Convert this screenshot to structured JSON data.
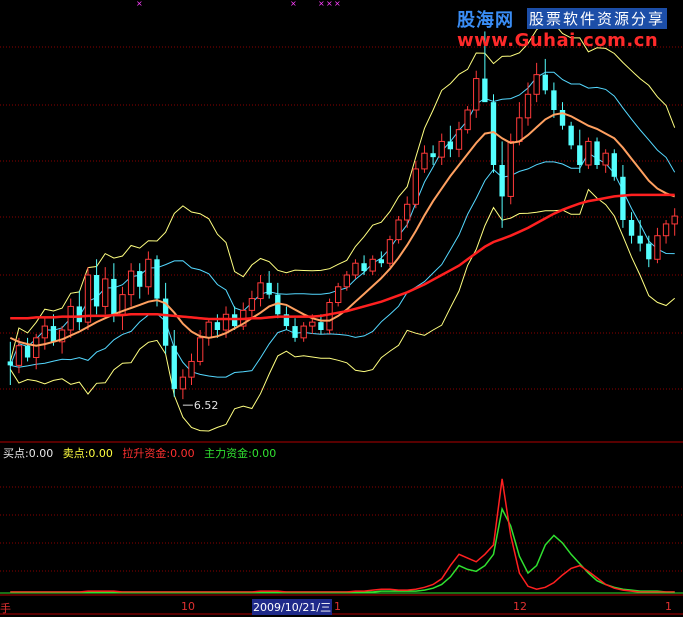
{
  "watermark": {
    "brand": "股海网",
    "slogan": "股票软件资源分享",
    "url": "www.Guhai.com.cn"
  },
  "indicator_legend": {
    "buy": {
      "label": "买点:0.00",
      "color": "#e8e8e8"
    },
    "sell": {
      "label": "卖点:0.00",
      "color": "#ffff40"
    },
    "pull_funds": {
      "label": "拉升资金:0.00",
      "color": "#ff3030"
    },
    "main_funds": {
      "label": "主力资金:0.00",
      "color": "#30e030"
    }
  },
  "x_axis": {
    "left_marker": "手",
    "tick_10": "10",
    "cursor_date": "2009/10/21/三",
    "tick_11": "1",
    "tick_12": "12",
    "right_marker": "1"
  },
  "colors": {
    "up": "#ff3a3a",
    "down": "#54ffff",
    "ma_short": "#ffa060",
    "ma_long": "#ff2020",
    "ma_green": "#30e030",
    "band_upper": "#ffff80",
    "band_cyan": "#54d8ff",
    "grid": "#8a0000"
  },
  "chart_data": [
    {
      "type": "candlestick",
      "title": "",
      "annotation": "6.52",
      "series": [
        {
          "name": "",
          "ohlc": [
            [
              7.0,
              7.25,
              6.7,
              6.95
            ],
            [
              6.95,
              7.3,
              6.85,
              7.2
            ],
            [
              7.2,
              7.3,
              7.0,
              7.05
            ],
            [
              7.05,
              7.35,
              6.9,
              7.3
            ],
            [
              7.3,
              7.55,
              7.15,
              7.45
            ],
            [
              7.45,
              7.6,
              7.2,
              7.25
            ],
            [
              7.25,
              7.45,
              7.1,
              7.4
            ],
            [
              7.4,
              7.8,
              7.3,
              7.7
            ],
            [
              7.7,
              7.9,
              7.4,
              7.5
            ],
            [
              7.5,
              8.2,
              7.4,
              8.1
            ],
            [
              8.1,
              8.3,
              7.6,
              7.7
            ],
            [
              7.7,
              8.2,
              7.6,
              8.05
            ],
            [
              8.05,
              8.25,
              7.5,
              7.6
            ],
            [
              7.6,
              7.95,
              7.4,
              7.85
            ],
            [
              7.85,
              8.25,
              7.7,
              8.15
            ],
            [
              8.15,
              8.25,
              7.8,
              7.95
            ],
            [
              7.95,
              8.4,
              7.85,
              8.3
            ],
            [
              8.3,
              8.35,
              7.7,
              7.8
            ],
            [
              7.8,
              8.0,
              7.1,
              7.2
            ],
            [
              7.2,
              7.4,
              6.55,
              6.65
            ],
            [
              6.65,
              6.9,
              6.52,
              6.8
            ],
            [
              6.8,
              7.1,
              6.7,
              7.0
            ],
            [
              7.0,
              7.4,
              6.95,
              7.3
            ],
            [
              7.3,
              7.55,
              7.2,
              7.5
            ],
            [
              7.5,
              7.6,
              7.3,
              7.4
            ],
            [
              7.4,
              7.7,
              7.3,
              7.6
            ],
            [
              7.6,
              7.7,
              7.4,
              7.45
            ],
            [
              7.45,
              7.75,
              7.4,
              7.65
            ],
            [
              7.65,
              7.9,
              7.55,
              7.8
            ],
            [
              7.8,
              8.1,
              7.7,
              8.0
            ],
            [
              8.0,
              8.15,
              7.8,
              7.85
            ],
            [
              7.85,
              8.0,
              7.55,
              7.6
            ],
            [
              7.6,
              7.7,
              7.4,
              7.45
            ],
            [
              7.45,
              7.55,
              7.25,
              7.3
            ],
            [
              7.3,
              7.5,
              7.25,
              7.45
            ],
            [
              7.45,
              7.6,
              7.35,
              7.5
            ],
            [
              7.5,
              7.6,
              7.35,
              7.4
            ],
            [
              7.4,
              7.8,
              7.35,
              7.75
            ],
            [
              7.75,
              8.0,
              7.7,
              7.95
            ],
            [
              7.95,
              8.15,
              7.9,
              8.1
            ],
            [
              8.1,
              8.3,
              8.05,
              8.25
            ],
            [
              8.25,
              8.35,
              8.1,
              8.15
            ],
            [
              8.15,
              8.35,
              8.1,
              8.3
            ],
            [
              8.3,
              8.4,
              8.2,
              8.25
            ],
            [
              8.25,
              8.6,
              8.2,
              8.55
            ],
            [
              8.55,
              8.85,
              8.5,
              8.8
            ],
            [
              8.8,
              9.1,
              8.7,
              9.0
            ],
            [
              9.0,
              9.55,
              8.95,
              9.45
            ],
            [
              9.45,
              9.75,
              9.4,
              9.65
            ],
            [
              9.65,
              9.75,
              9.5,
              9.6
            ],
            [
              9.6,
              9.9,
              9.5,
              9.8
            ],
            [
              9.8,
              10.0,
              9.6,
              9.7
            ],
            [
              9.7,
              10.05,
              9.6,
              9.95
            ],
            [
              9.95,
              10.25,
              9.9,
              10.2
            ],
            [
              10.2,
              10.7,
              10.1,
              10.6
            ],
            [
              10.6,
              11.2,
              10.4,
              10.3
            ],
            [
              10.3,
              10.4,
              9.4,
              9.5
            ],
            [
              9.5,
              9.8,
              8.7,
              9.1
            ],
            [
              9.1,
              9.9,
              9.0,
              9.8
            ],
            [
              9.8,
              10.3,
              9.75,
              10.1
            ],
            [
              10.1,
              10.55,
              10.0,
              10.4
            ],
            [
              10.4,
              10.8,
              10.3,
              10.65
            ],
            [
              10.65,
              10.85,
              10.4,
              10.45
            ],
            [
              10.45,
              10.55,
              10.1,
              10.2
            ],
            [
              10.2,
              10.3,
              9.95,
              10.0
            ],
            [
              10.0,
              10.05,
              9.7,
              9.75
            ],
            [
              9.75,
              9.95,
              9.4,
              9.5
            ],
            [
              9.5,
              9.85,
              9.45,
              9.8
            ],
            [
              9.8,
              9.85,
              9.45,
              9.5
            ],
            [
              9.5,
              9.7,
              9.4,
              9.65
            ],
            [
              9.65,
              9.7,
              9.3,
              9.35
            ],
            [
              9.35,
              9.5,
              8.7,
              8.8
            ],
            [
              8.8,
              8.9,
              8.5,
              8.6
            ],
            [
              8.6,
              8.8,
              8.4,
              8.5
            ],
            [
              8.5,
              8.6,
              8.2,
              8.3
            ],
            [
              8.3,
              8.7,
              8.25,
              8.6
            ],
            [
              8.6,
              8.8,
              8.5,
              8.75
            ],
            [
              8.75,
              8.95,
              8.6,
              8.85
            ]
          ]
        },
        {
          "name": "",
          "type": "line",
          "values": [
            7.3,
            7.25,
            7.22,
            7.2,
            7.22,
            7.25,
            7.28,
            7.33,
            7.38,
            7.44,
            7.5,
            7.55,
            7.6,
            7.64,
            7.68,
            7.72,
            7.76,
            7.78,
            7.74,
            7.62,
            7.48,
            7.38,
            7.32,
            7.3,
            7.32,
            7.36,
            7.42,
            7.48,
            7.55,
            7.62,
            7.7,
            7.74,
            7.72,
            7.66,
            7.6,
            7.55,
            7.52,
            7.52,
            7.58,
            7.66,
            7.76,
            7.86,
            7.96,
            8.06,
            8.18,
            8.32,
            8.48,
            8.66,
            8.86,
            9.04,
            9.2,
            9.36,
            9.5,
            9.64,
            9.78,
            9.9,
            9.92,
            9.84,
            9.78,
            9.8,
            9.88,
            9.98,
            10.08,
            10.14,
            10.16,
            10.12,
            10.06,
            10.0,
            9.96,
            9.9,
            9.84,
            9.72,
            9.58,
            9.44,
            9.3,
            9.2,
            9.14,
            9.1
          ]
        },
        {
          "name": "",
          "type": "line",
          "values": [
            7.55,
            7.55,
            7.55,
            7.56,
            7.56,
            7.56,
            7.57,
            7.57,
            7.57,
            7.58,
            7.58,
            7.58,
            7.59,
            7.59,
            7.6,
            7.6,
            7.6,
            7.6,
            7.59,
            7.58,
            7.57,
            7.56,
            7.55,
            7.54,
            7.54,
            7.54,
            7.54,
            7.54,
            7.55,
            7.55,
            7.56,
            7.57,
            7.57,
            7.57,
            7.57,
            7.57,
            7.58,
            7.6,
            7.62,
            7.64,
            7.67,
            7.7,
            7.73,
            7.76,
            7.8,
            7.84,
            7.88,
            7.93,
            7.98,
            8.04,
            8.1,
            8.16,
            8.22,
            8.3,
            8.38,
            8.46,
            8.52,
            8.56,
            8.6,
            8.65,
            8.7,
            8.76,
            8.82,
            8.88,
            8.93,
            8.97,
            9.01,
            9.04,
            9.06,
            9.08,
            9.1,
            9.11,
            9.12,
            9.12,
            9.12,
            9.12,
            9.12,
            9.12
          ]
        }
      ]
    },
    {
      "type": "line",
      "title": "",
      "series": [
        {
          "name": "拉升资金",
          "values": [
            0,
            0,
            0,
            0,
            0,
            0,
            0,
            0,
            0,
            1,
            1,
            1,
            1,
            0,
            0,
            0,
            0,
            0,
            0,
            0,
            0,
            0,
            0,
            0,
            0,
            0,
            0,
            0,
            0,
            1,
            1,
            1,
            0,
            0,
            0,
            0,
            0,
            0,
            0,
            0,
            1,
            1,
            2,
            3,
            3,
            2,
            2,
            3,
            5,
            8,
            14,
            28,
            40,
            36,
            32,
            40,
            50,
            120,
            60,
            20,
            6,
            3,
            5,
            10,
            18,
            25,
            28,
            22,
            15,
            8,
            4,
            2,
            1,
            0,
            0,
            0,
            0,
            0
          ]
        },
        {
          "name": "主力资金",
          "values": [
            0,
            0,
            0,
            0,
            0,
            0,
            0,
            0,
            0,
            0,
            0,
            0,
            0,
            0,
            0,
            0,
            0,
            0,
            0,
            0,
            0,
            0,
            0,
            0,
            0,
            0,
            0,
            0,
            0,
            0,
            0,
            0,
            0,
            0,
            0,
            0,
            0,
            0,
            0,
            0,
            0,
            0,
            0,
            1,
            1,
            1,
            1,
            1,
            2,
            4,
            8,
            16,
            28,
            24,
            22,
            28,
            40,
            88,
            70,
            38,
            20,
            28,
            50,
            60,
            52,
            40,
            30,
            20,
            12,
            8,
            5,
            3,
            2,
            1,
            1,
            1,
            0,
            0
          ]
        }
      ]
    }
  ]
}
